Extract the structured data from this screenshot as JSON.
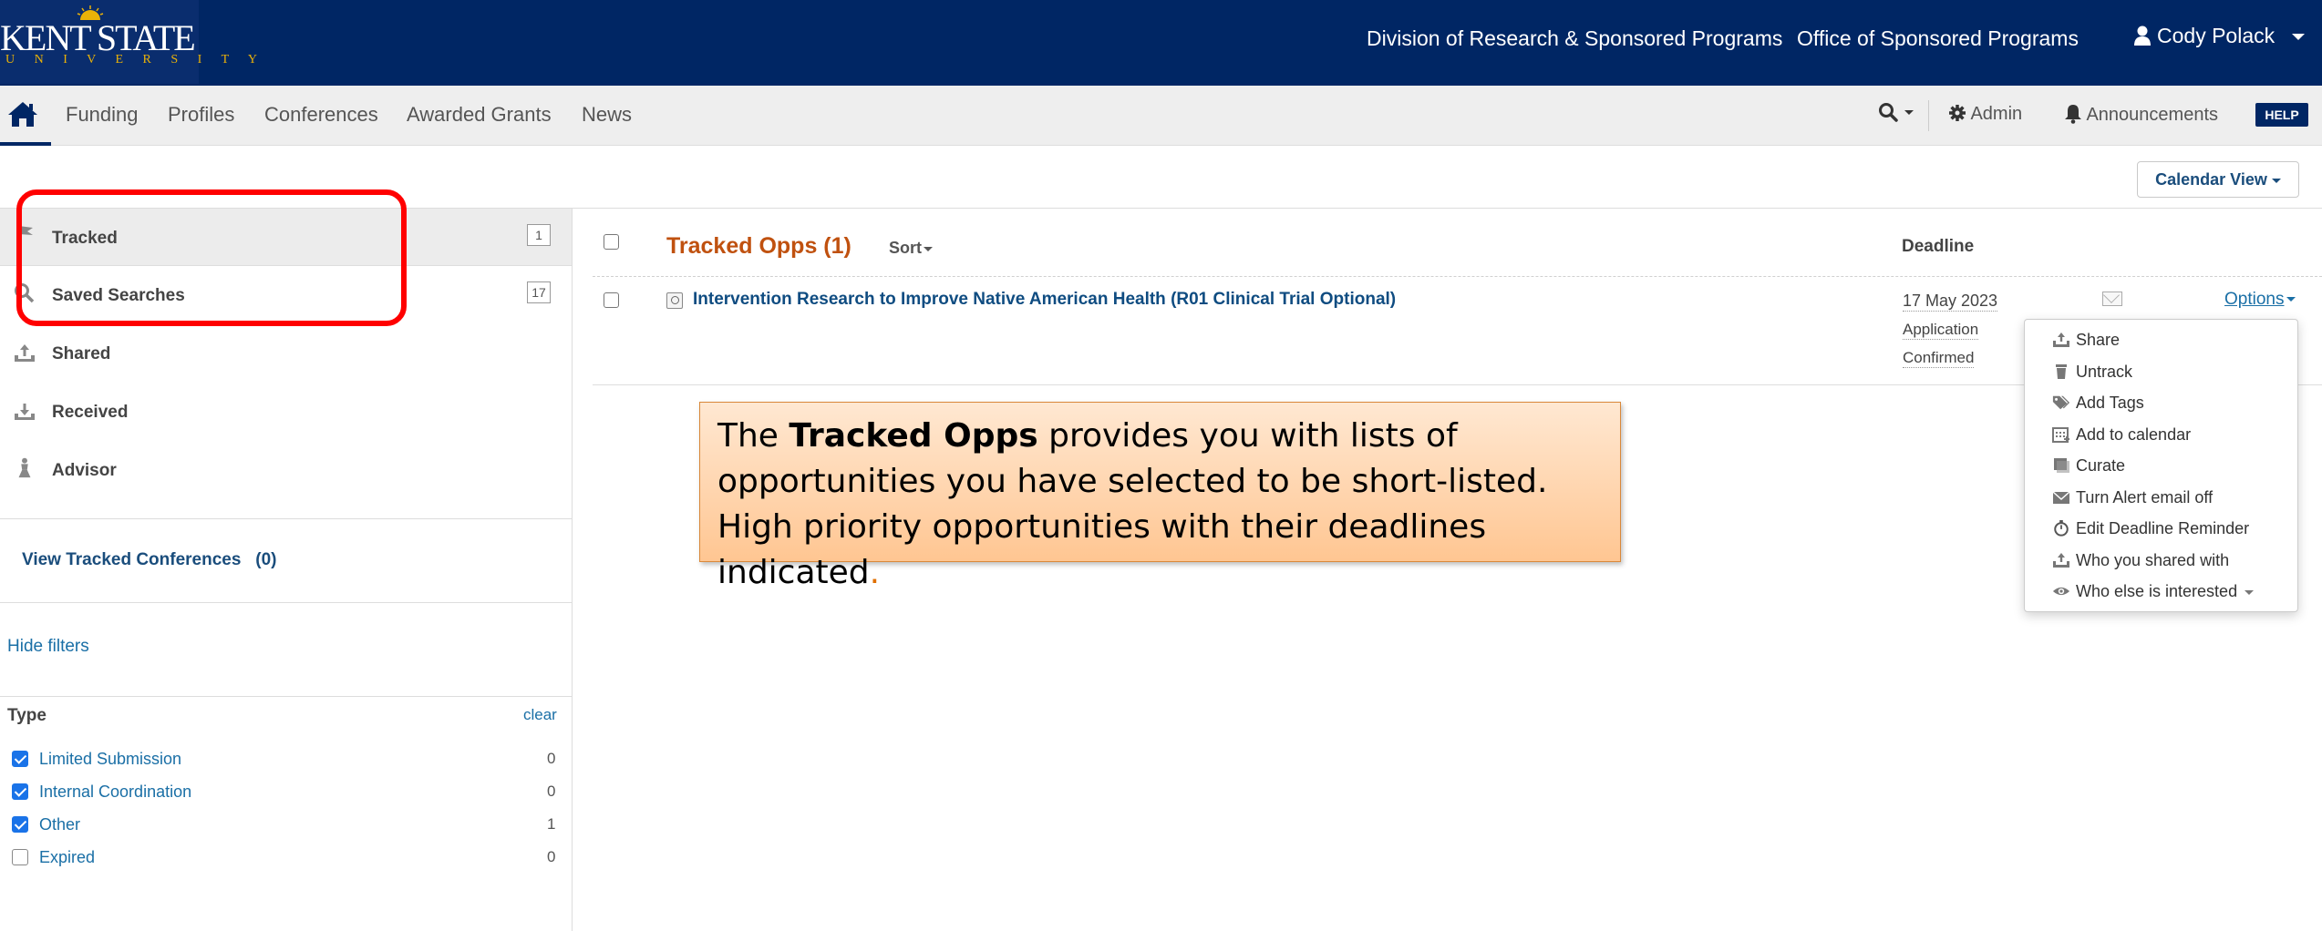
{
  "brand": {
    "name": "KENT STATE",
    "sub": "U N I V E R S I T Y",
    "color_primary": "#002664",
    "color_gold": "#eab208"
  },
  "topbar": {
    "link_division": "Division of Research & Sponsored Programs",
    "link_office": "Office of Sponsored Programs",
    "user_name": "Cody Polack",
    "user_icon": "user-icon"
  },
  "nav": {
    "home_icon": "home-icon",
    "items": [
      "Funding",
      "Profiles",
      "Conferences",
      "Awarded Grants",
      "News"
    ],
    "admin": "Admin",
    "announcements": "Announcements",
    "help": "HELP"
  },
  "calendar_view": "Calendar View",
  "sidebar": {
    "items": [
      {
        "label": "Tracked",
        "count": "1",
        "icon": "flag-icon"
      },
      {
        "label": "Saved Searches",
        "count": "17",
        "icon": "search-icon"
      },
      {
        "label": "Shared",
        "icon": "share-icon"
      },
      {
        "label": "Received",
        "icon": "inbox-icon"
      },
      {
        "label": "Advisor",
        "icon": "advisor-icon"
      }
    ],
    "view_tracked_conferences": "View Tracked Conferences",
    "view_tracked_conferences_count": "(0)",
    "hide_filters": "Hide filters",
    "type_title": "Type",
    "clear": "clear",
    "filters": [
      {
        "label": "Limited Submission",
        "count": "0",
        "checked": true
      },
      {
        "label": "Internal Coordination",
        "count": "0",
        "checked": true
      },
      {
        "label": "Other",
        "count": "1",
        "checked": true
      },
      {
        "label": "Expired",
        "count": "0",
        "checked": false
      }
    ]
  },
  "main": {
    "title": "Tracked Opps (1)",
    "sort": "Sort",
    "deadline_header": "Deadline",
    "opportunity": {
      "title": "Intervention Research to Improve Native American Health (R01 Clinical Trial Optional)",
      "deadline_date": "17 May 2023",
      "deadline_line2": "Application",
      "deadline_line3": "Confirmed",
      "options": "Options"
    }
  },
  "options_menu": [
    {
      "label": "Share",
      "icon": "share-icon"
    },
    {
      "label": "Untrack",
      "icon": "trash-icon"
    },
    {
      "label": "Add Tags",
      "icon": "tags-icon"
    },
    {
      "label": "Add to calendar",
      "icon": "calendar-icon"
    },
    {
      "label": "Curate",
      "icon": "curate-icon"
    },
    {
      "label": "Turn Alert email off",
      "icon": "envelope-icon"
    },
    {
      "label": "Edit Deadline Reminder",
      "icon": "stopwatch-icon"
    },
    {
      "label": "Who you shared with",
      "icon": "share-icon"
    },
    {
      "label": "Who else is interested",
      "icon": "eye-icon"
    }
  ],
  "callout": {
    "part1": "The ",
    "bold": "Tracked Opps",
    "part2": " provides you with lists of opportunities you have selected to be short-listed. High priority opportunities with their deadlines indicated",
    "period": "."
  }
}
